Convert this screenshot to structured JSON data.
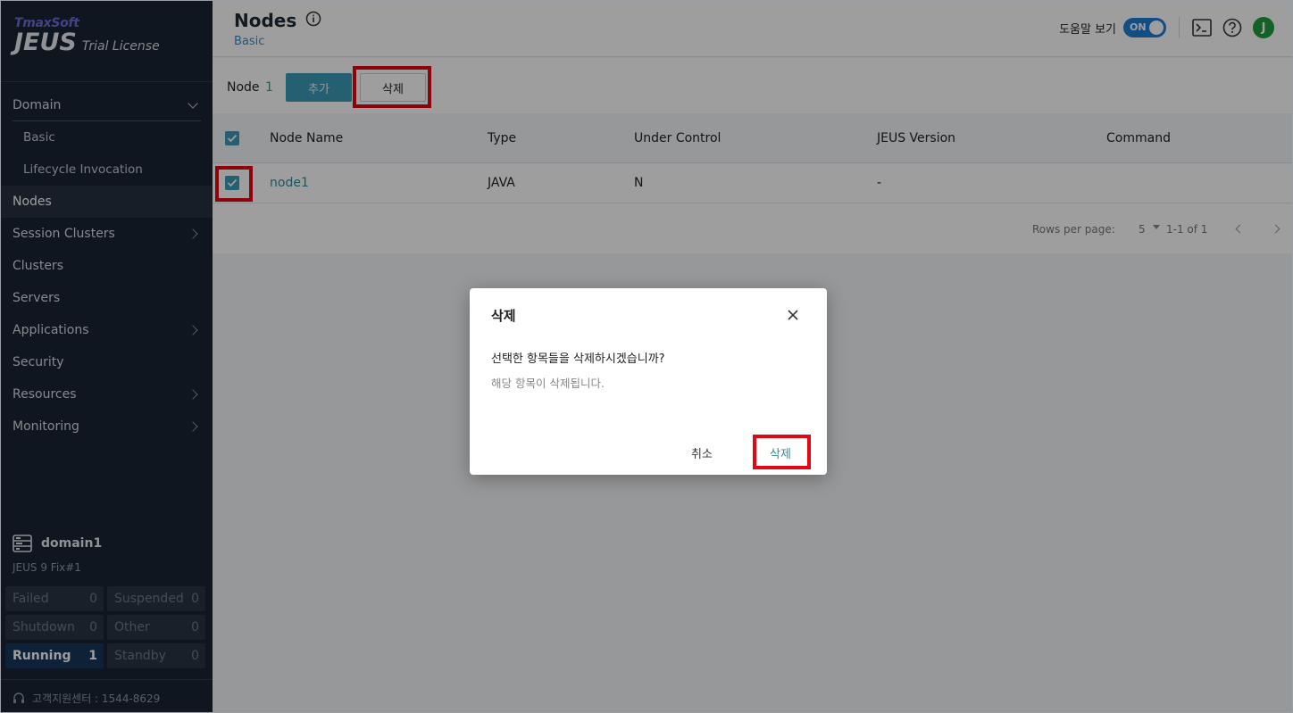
{
  "logo": {
    "brand": "TmaxSoft",
    "product": "JEUS",
    "license": "Trial License"
  },
  "sidebar": {
    "items": [
      {
        "label": "Domain",
        "chevron": "down"
      },
      {
        "label": "Basic",
        "sub": true
      },
      {
        "label": "Lifecycle Invocation",
        "sub": true
      },
      {
        "label": "Nodes",
        "active": true
      },
      {
        "label": "Session Clusters",
        "chevron": "right"
      },
      {
        "label": "Clusters"
      },
      {
        "label": "Servers"
      },
      {
        "label": "Applications",
        "chevron": "right"
      },
      {
        "label": "Security"
      },
      {
        "label": "Resources",
        "chevron": "right"
      },
      {
        "label": "Monitoring",
        "chevron": "right"
      }
    ],
    "domain_name": "domain1",
    "domain_version": "JEUS 9 Fix#1",
    "status": [
      {
        "label": "Failed",
        "count": "0"
      },
      {
        "label": "Suspended",
        "count": "0"
      },
      {
        "label": "Shutdown",
        "count": "0"
      },
      {
        "label": "Other",
        "count": "0"
      },
      {
        "label": "Running",
        "count": "1"
      },
      {
        "label": "Standby",
        "count": "0"
      }
    ],
    "support": "고객지원센터 : 1544-8629"
  },
  "header": {
    "title": "Nodes",
    "breadcrumb": "Basic",
    "help_label": "도움말 보기",
    "toggle": "ON",
    "avatar": "J"
  },
  "toolbar": {
    "label": "Node",
    "count": "1",
    "add_label": "추가",
    "delete_label": "삭제"
  },
  "table": {
    "columns": [
      "Node Name",
      "Type",
      "Under Control",
      "JEUS Version",
      "Command"
    ],
    "rows": [
      {
        "name": "node1",
        "type": "JAVA",
        "under_control": "N",
        "version": "-",
        "command": ""
      }
    ]
  },
  "pager": {
    "rows_label": "Rows per page:",
    "rows_value": "5",
    "range": "1-1 of 1"
  },
  "modal": {
    "title": "삭제",
    "question": "선택한 항목들을 삭제하시겠습니까?",
    "sub": "해당 항목이 삭제됩니다.",
    "cancel": "취소",
    "confirm": "삭제"
  },
  "colors": {
    "accent": "#3b9ab8",
    "highlight": "#e30613",
    "sidebar_bg": "#1b2533"
  }
}
